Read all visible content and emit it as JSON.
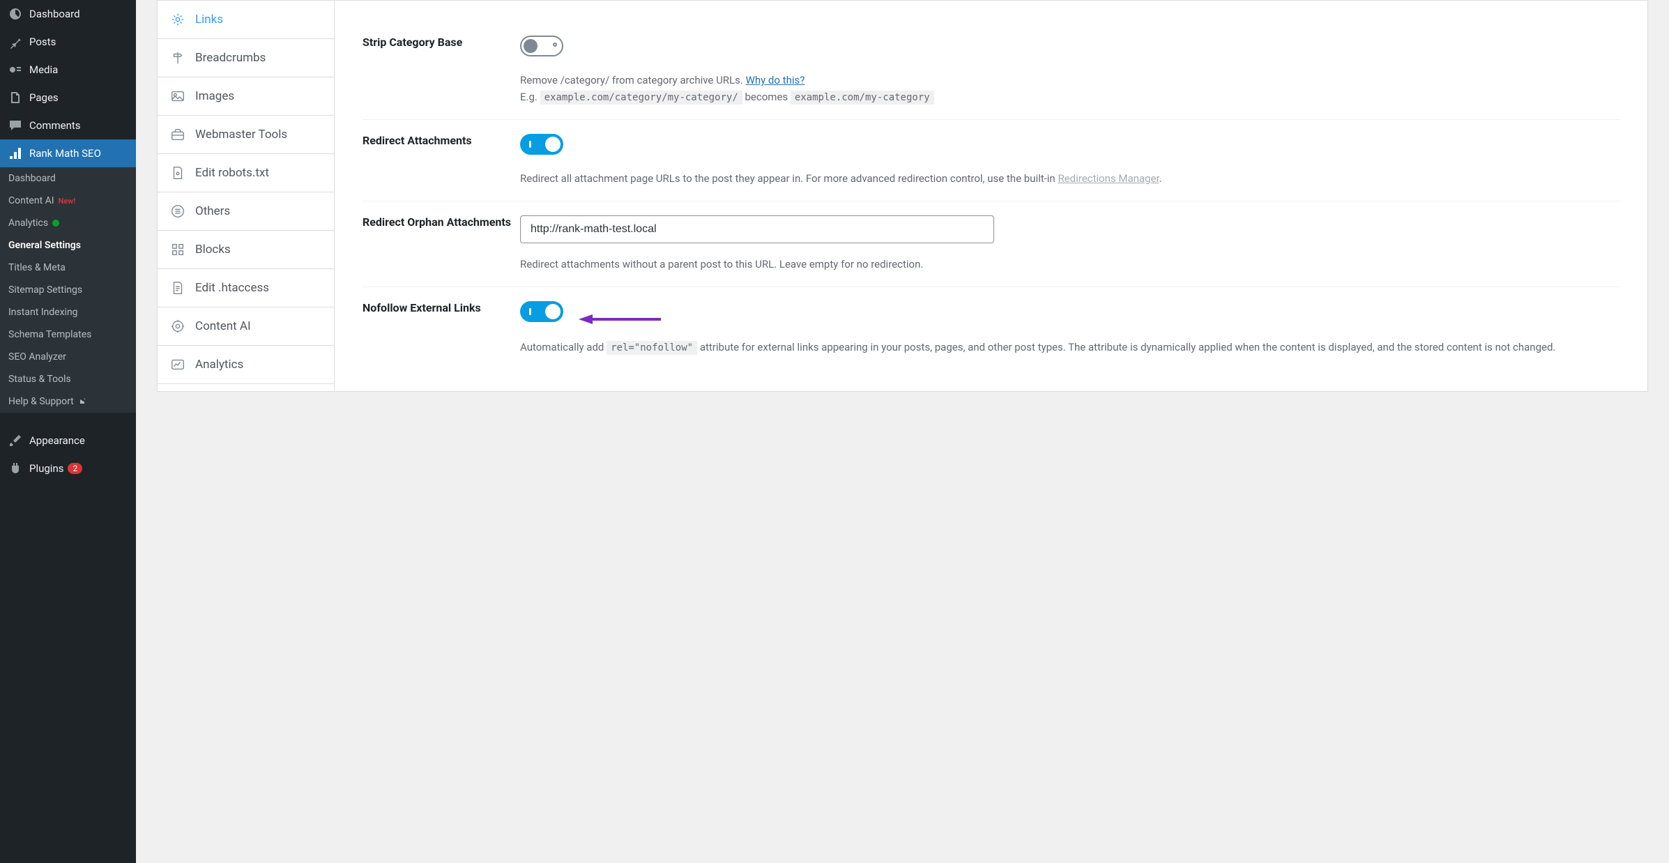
{
  "sidebar": {
    "items": [
      {
        "label": "Dashboard"
      },
      {
        "label": "Posts"
      },
      {
        "label": "Media"
      },
      {
        "label": "Pages"
      },
      {
        "label": "Comments"
      },
      {
        "label": "Rank Math SEO"
      },
      {
        "label": "Appearance"
      },
      {
        "label": "Plugins",
        "badge": "2"
      }
    ],
    "submenu": [
      {
        "label": "Dashboard"
      },
      {
        "label": "Content AI",
        "new": "New!"
      },
      {
        "label": "Analytics",
        "dot": true
      },
      {
        "label": "General Settings",
        "bold": true
      },
      {
        "label": "Titles & Meta"
      },
      {
        "label": "Sitemap Settings"
      },
      {
        "label": "Instant Indexing"
      },
      {
        "label": "Schema Templates"
      },
      {
        "label": "SEO Analyzer"
      },
      {
        "label": "Status & Tools"
      },
      {
        "label": "Help & Support",
        "ext": true
      }
    ]
  },
  "innerNav": {
    "items": [
      {
        "label": "Links",
        "active": true
      },
      {
        "label": "Breadcrumbs"
      },
      {
        "label": "Images"
      },
      {
        "label": "Webmaster Tools"
      },
      {
        "label": "Edit robots.txt"
      },
      {
        "label": "Others"
      },
      {
        "label": "Blocks"
      },
      {
        "label": "Edit .htaccess"
      },
      {
        "label": "Content AI"
      },
      {
        "label": "Analytics"
      }
    ]
  },
  "settings": {
    "stripCategory": {
      "label": "Strip Category Base",
      "on": false,
      "desc1": "Remove /category/ from category archive URLs. ",
      "link": "Why do this?",
      "desc2": "E.g. ",
      "code1": "example.com/category/my-category/",
      "desc3": " becomes ",
      "code2": "example.com/my-category"
    },
    "redirectAttachments": {
      "label": "Redirect Attachments",
      "on": true,
      "desc1": "Redirect all attachment page URLs to the post they appear in. For more advanced redirection control, use the built-in ",
      "link": "Redirections Manager",
      "desc2": "."
    },
    "redirectOrphan": {
      "label": "Redirect Orphan Attachments",
      "value": "http://rank-math-test.local",
      "desc": "Redirect attachments without a parent post to this URL. Leave empty for no redirection."
    },
    "nofollow": {
      "label": "Nofollow External Links",
      "on": true,
      "desc1": "Automatically add ",
      "code": "rel=\"nofollow\"",
      "desc2": " attribute for external links appearing in your posts, pages, and other post types. The attribute is dynamically applied when the content is displayed, and the stored content is not changed."
    }
  }
}
